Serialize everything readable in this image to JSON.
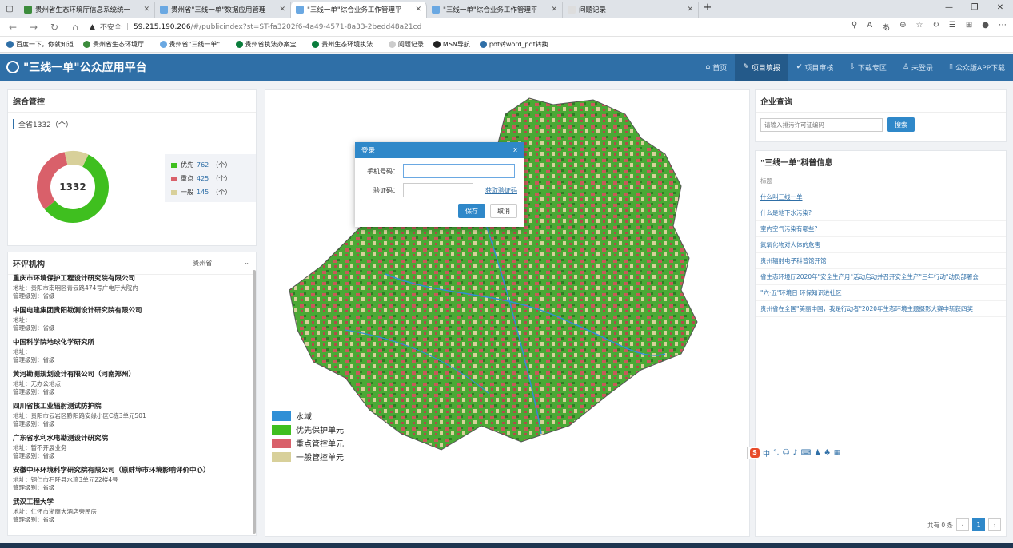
{
  "browser": {
    "tabs": [
      {
        "label": "贵州省生态环境厅信息系统统一",
        "color": "#3c8c3c",
        "active": false
      },
      {
        "label": "贵州省\"三线一单\"数据应用管理",
        "color": "#6aa8e2",
        "active": false
      },
      {
        "label": "\"三线一单\"综合业务工作管理平",
        "color": "#6aa8e2",
        "active": true
      },
      {
        "label": "\"三线一单\"综合业务工作管理平",
        "color": "#6aa8e2",
        "active": false
      },
      {
        "label": "问题记录",
        "color": "#dddddd",
        "active": false
      }
    ],
    "security_text": "不安全",
    "url_host": "59.215.190.206",
    "url_path": "/#/publicindex?st=ST-fa3202f6-4a49-4571-8a33-2bedd48a21cd",
    "bookmarks": [
      "百度一下，你就知道",
      "贵州省生态环境厅...",
      "贵州省\"三线一单\"...",
      "贵州省执法办案宝...",
      "贵州生态环境执法...",
      "问题记录",
      "MSN导航",
      "pdf转word_pdf转换..."
    ]
  },
  "header": {
    "title": "\"三线一单\"公众应用平台",
    "nav": [
      {
        "label": "首页",
        "active": false
      },
      {
        "label": "项目填报",
        "active": true
      },
      {
        "label": "项目审核",
        "active": false
      },
      {
        "label": "下载专区",
        "active": false
      },
      {
        "label": "未登录",
        "active": false
      },
      {
        "label": "公众版APP下载",
        "active": false
      }
    ]
  },
  "overview": {
    "title": "综合管控",
    "total_text": "全省1332（个）",
    "center_value": "1332",
    "legend": [
      {
        "label": "优先",
        "value": "762",
        "unit": "（个）",
        "color": "#3fbf1f"
      },
      {
        "label": "重点",
        "value": "425",
        "unit": "（个）",
        "color": "#d9606a"
      },
      {
        "label": "一般",
        "value": "145",
        "unit": "（个）",
        "color": "#d8d09a"
      }
    ],
    "chart_data": {
      "type": "pie",
      "categories": [
        "优先",
        "重点",
        "一般"
      ],
      "values": [
        762,
        425,
        145
      ],
      "colors": [
        "#3fbf1f",
        "#d9606a",
        "#d8d09a"
      ]
    }
  },
  "orgs": {
    "title": "环评机构",
    "filter": "贵州省",
    "items": [
      {
        "name": "重庆市环境保护工程设计研究院有限公司",
        "addr": "地址：贵阳市南明区青云路474号广电厅大院内",
        "level": "管理级别：省级"
      },
      {
        "name": "中国电建集团贵阳勘测设计研究院有限公司",
        "addr": "地址：",
        "level": "管理级别：省级"
      },
      {
        "name": "中国科学院地球化学研究所",
        "addr": "地址：",
        "level": "管理级别：省级"
      },
      {
        "name": "黄河勘测规划设计有限公司（河南郑州）",
        "addr": "地址：无办公地点",
        "level": "管理级别：省级"
      },
      {
        "name": "四川省核工业辐射测试防护院",
        "addr": "地址：贵阳市云岩区黔阳路安缘小区C栋3单元501",
        "level": "管理级别：省级"
      },
      {
        "name": "广东省水利水电勘测设计研究院",
        "addr": "地址：暂不开展业务",
        "level": "管理级别：省级"
      },
      {
        "name": "安徽中环环境科学研究院有限公司（原蚌埠市环境影响评价中心）",
        "addr": "地址：铜仁市石阡县水湾3单元22楼4号",
        "level": "管理级别：省级"
      },
      {
        "name": "武汉工程大学",
        "addr": "地址：仁怀市浙商大酒店旁民房",
        "level": "管理级别：省级"
      }
    ]
  },
  "map": {
    "legend": [
      {
        "label": "水域",
        "color": "#2f8fd6"
      },
      {
        "label": "优先保护单元",
        "color": "#3fbf1f"
      },
      {
        "label": "重点管控单元",
        "color": "#d9606a"
      },
      {
        "label": "一般管控单元",
        "color": "#d8d09a"
      }
    ]
  },
  "login": {
    "title": "登录",
    "close": "x",
    "phone_label": "手机号码：",
    "code_label": "验证码：",
    "get_code": "获取验证码",
    "save": "保存",
    "cancel": "取消"
  },
  "company": {
    "title": "企业查询",
    "placeholder": "请输入排污许可证编码",
    "search": "搜索"
  },
  "science": {
    "title": "\"三线一单\"科普信息",
    "col_header": "标题",
    "items": [
      "什么叫三线一单",
      "什么是地下水污染?",
      "室内空气污染有哪些?",
      "氮氧化物对人体的危害",
      "贵州辐射电子科普馆开馆",
      "省生态环境厅2020年\"安全生产月\"活动启动并召开安全生产\"三年行动\"动员部署会",
      "\"六·五\"环境日 环保知识进社区",
      "贵州省在全国\"美丽中国，我是行动者\"2020年生态环境主题摄影大赛中斩获四奖"
    ],
    "pager_total": "共有 0 条",
    "page": "1"
  }
}
